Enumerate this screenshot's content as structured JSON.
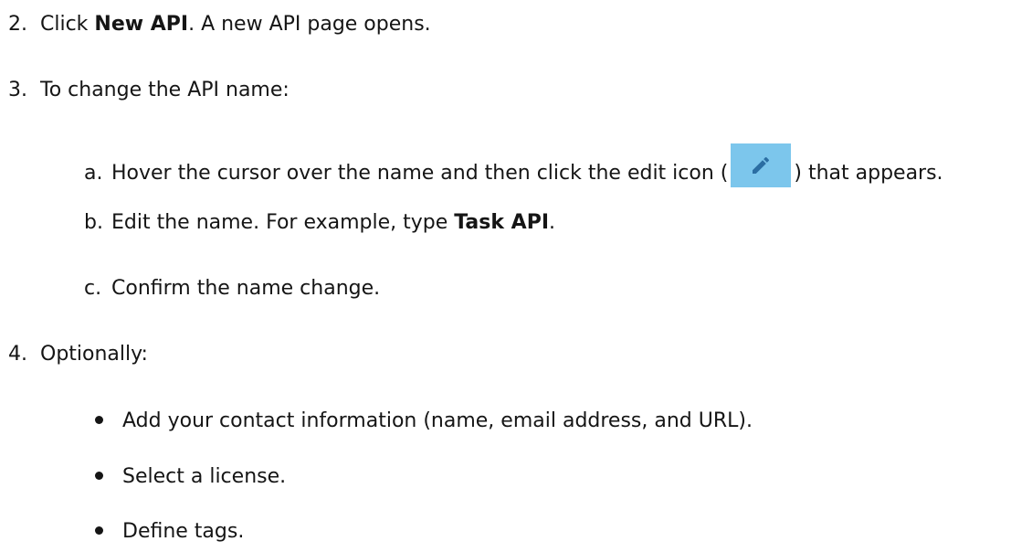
{
  "steps": [
    {
      "number": "2.",
      "pre": "Click ",
      "bold": "New API",
      "post": ". A new API page opens."
    },
    {
      "number": "3.",
      "text": "To change the API name:",
      "substeps": [
        {
          "letter": "a.",
          "pre": "Hover the cursor over the name and then click the edit icon (",
          "icon": "pencil-edit-icon",
          "post": ") that appears."
        },
        {
          "letter": "b.",
          "pre": "Edit the name. For example, type ",
          "bold": "Task API",
          "post": "."
        },
        {
          "letter": "c.",
          "text": "Confirm the name change."
        }
      ]
    },
    {
      "number": "4.",
      "text": "Optionally:",
      "bullets": [
        "Add your contact information (name, email address, and URL).",
        "Select a license.",
        "Define tags."
      ]
    }
  ],
  "colors": {
    "text": "#151515",
    "icon_background": "#7cc6ec",
    "icon_pencil": "#2b6ea3"
  }
}
